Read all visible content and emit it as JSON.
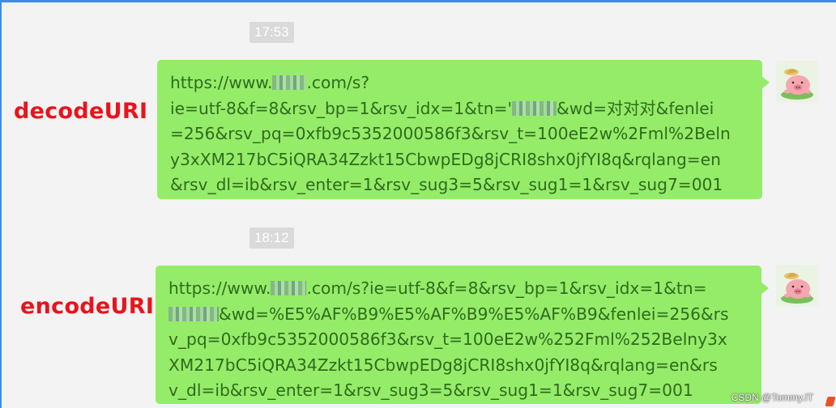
{
  "chat": {
    "timestamp_1": "17:53",
    "timestamp_2": "18:12"
  },
  "labels": {
    "decode": "decodeURI",
    "encode": "encodeURI"
  },
  "message_1": {
    "line_1_prefix": "https://www.",
    "line_1_suffix": ".com/s?",
    "line_2_prefix": "ie=utf-8&f=8&rsv_bp=1&rsv_idx=1&tn='",
    "line_2_suffix": "&wd=对对对&fenlei",
    "line_3": "=256&rsv_pq=0xfb9c5352000586f3&rsv_t=100eE2w%2Fml%2Beln",
    "line_4": "y3xXM217bC5iQRA34Zzkt15CbwpEDg8jCRI8shx0jfYI8q&rqlang=en",
    "line_5": "&rsv_dl=ib&rsv_enter=1&rsv_sug3=5&rsv_sug1=1&rsv_sug7=001"
  },
  "message_2": {
    "line_1_prefix": "https://www.",
    "line_1_suffix": ".com/s?ie=utf-8&f=8&rsv_bp=1&rsv_idx=1&tn=",
    "line_2_suffix": "&wd=%E5%AF%B9%E5%AF%B9%E5%AF%B9&fenlei=256&rs",
    "line_3": "v_pq=0xfb9c5352000586f3&rsv_t=100eE2w%252Fml%252Belny3x",
    "line_4": "XM217bC5iQRA34Zzkt15CbwpEDg8jCRI8shx0jfYI8q&rqlang=en&rs",
    "line_5": "v_dl=ib&rsv_enter=1&rsv_sug3=5&rsv_sug1=1&rsv_sug7=001"
  },
  "footer": {
    "watermark": "CSDN @Tommy.IT"
  }
}
